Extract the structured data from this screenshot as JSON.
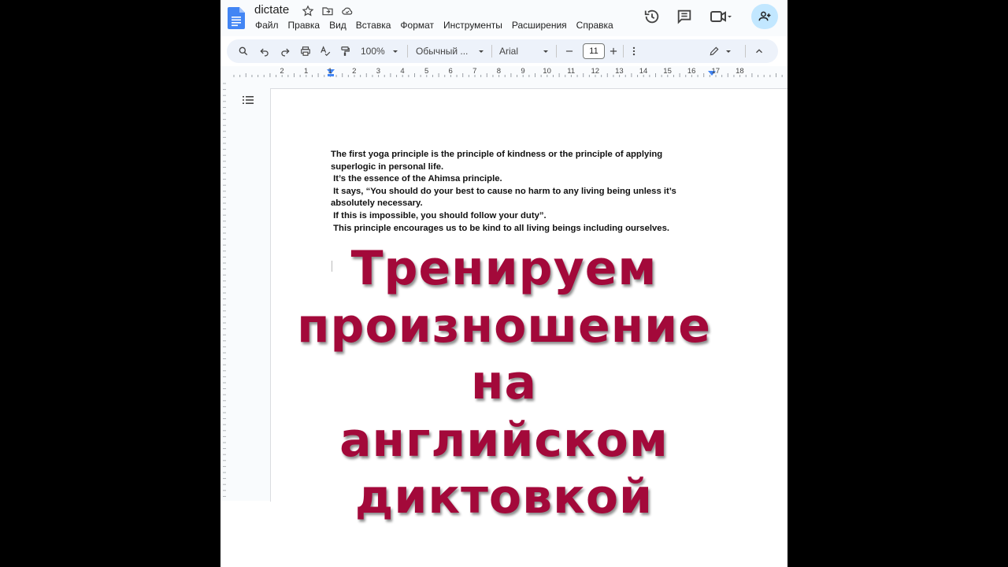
{
  "header": {
    "title": "dictate",
    "menu": [
      "Файл",
      "Правка",
      "Вид",
      "Вставка",
      "Формат",
      "Инструменты",
      "Расширения",
      "Справка"
    ]
  },
  "toolbar": {
    "zoom": "100%",
    "style": "Обычный ...",
    "font": "Arial",
    "font_size": "11"
  },
  "ruler": {
    "labels": [
      "2",
      "1",
      "1",
      "2",
      "3",
      "4",
      "5",
      "6",
      "7",
      "8",
      "9",
      "10",
      "11",
      "12",
      "13",
      "14",
      "15",
      "16",
      "17",
      "18"
    ]
  },
  "document": {
    "lines": [
      "The first yoga principle is the principle of kindness or the principle of applying",
      "superlogic in personal life.",
      " It’s the essence of the Ahimsa principle.",
      " It says, “You should do your best to cause no harm to any living being unless it’s",
      "absolutely necessary.",
      " If this is impossible, you should follow your duty”.",
      " This principle encourages us to be kind to all living beings including ourselves."
    ]
  },
  "overlay": {
    "lines": [
      "Тренируем",
      "произношение",
      "на",
      "английском",
      "диктовкой"
    ]
  },
  "colors": {
    "overlay_text": "#a3093a",
    "share_button": "#c2e7ff",
    "docs_blue": "#4285f4"
  }
}
